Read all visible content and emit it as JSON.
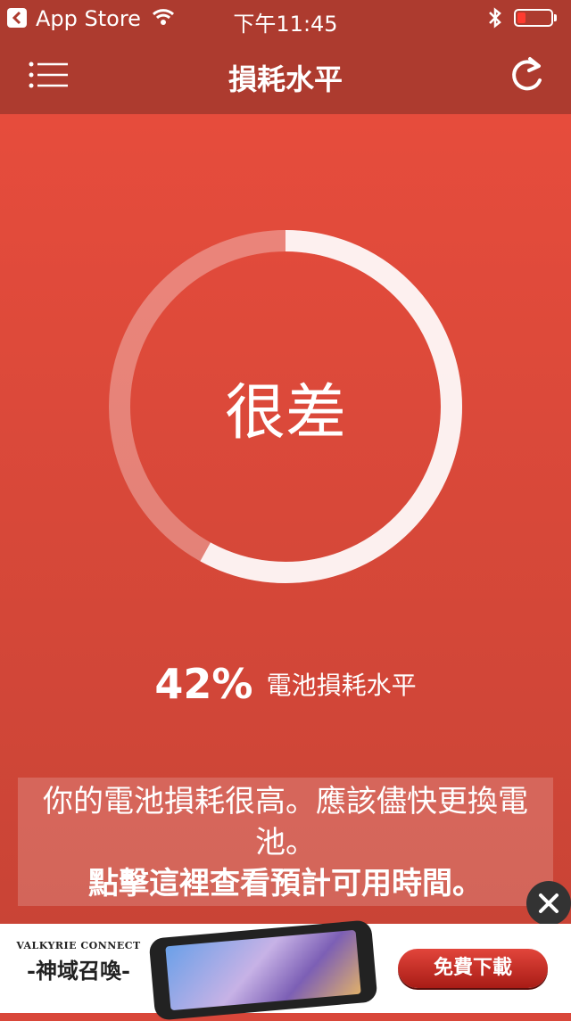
{
  "status_bar": {
    "back_app": "App Store",
    "time": "下午11:45",
    "battery_level": 0.25,
    "battery_color": "#ff3b30",
    "icons": [
      "back-icon",
      "wifi-icon",
      "bluetooth-icon",
      "battery-icon"
    ]
  },
  "nav": {
    "title": "損耗水平",
    "left_icon": "menu-icon",
    "right_icon": "refresh-icon"
  },
  "gauge": {
    "status_text": "很差",
    "wear_percent": 42
  },
  "stat": {
    "value": "42%",
    "label": "電池損耗水平"
  },
  "message": {
    "line1": "你的電池損耗很高。應該儘快更換電池。",
    "cta": "點擊這裡查看預計可用時間。"
  },
  "ad": {
    "brand_en": "VALKYRIE CONNECT",
    "brand_zh": "-神域召喚-",
    "button": "免費下載",
    "close_icon": "close-icon"
  },
  "colors": {
    "header": "#ad3b2f",
    "background_top": "#e64c3c",
    "background_bottom": "#c94436",
    "ad_button": "#c0281f"
  }
}
